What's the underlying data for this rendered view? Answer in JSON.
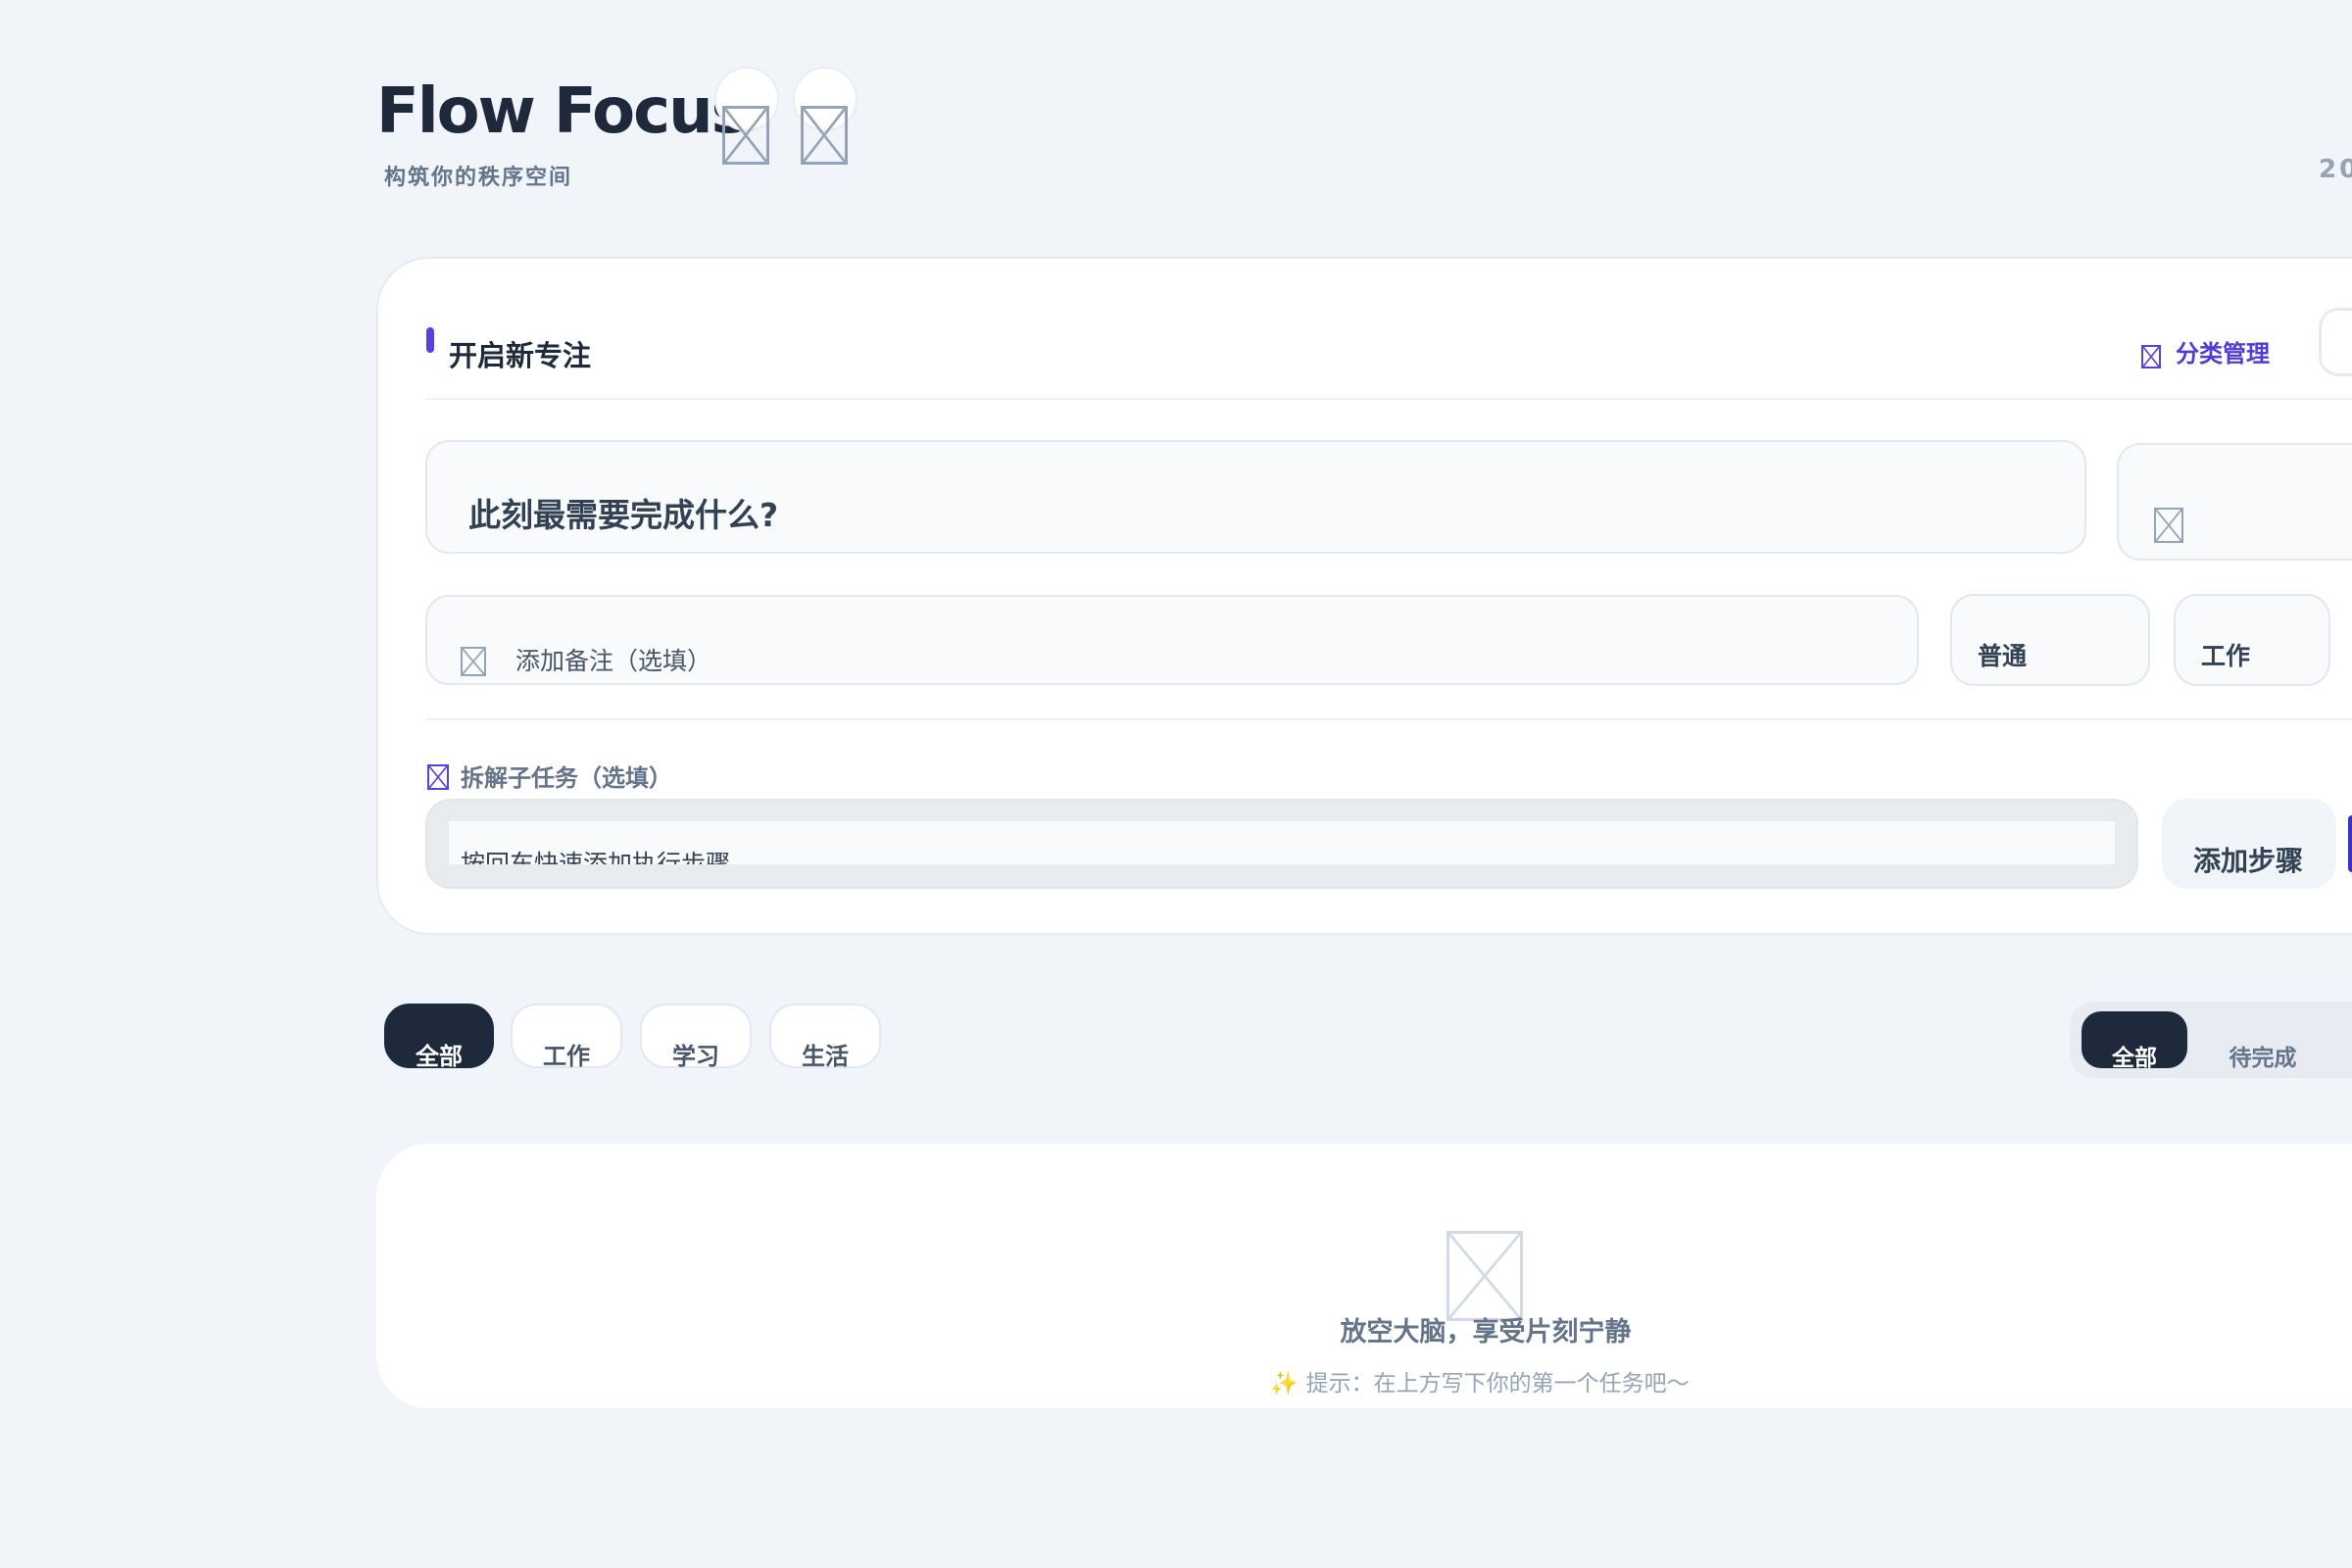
{
  "header": {
    "title": "Flow Focus",
    "subtitle": "构筑你的秩序空间",
    "date_fragment": "20"
  },
  "composer": {
    "section_title": "开启新专注",
    "category_manage_label": "分类管理",
    "task_placeholder": "此刻最需要完成什么?",
    "note_placeholder": "添加备注（选填）",
    "priority_value": "普通",
    "category_value": "工作",
    "subtask_label": "拆解子任务（选填）",
    "subtask_placeholder": "按回车快速添加执行步骤",
    "add_step_label": "添加步骤"
  },
  "filters": {
    "categories": [
      {
        "label": "全部",
        "active": true
      },
      {
        "label": "工作",
        "active": false
      },
      {
        "label": "学习",
        "active": false
      },
      {
        "label": "生活",
        "active": false
      }
    ],
    "status": [
      {
        "label": "全部",
        "active": true
      },
      {
        "label": "待完成",
        "active": false
      }
    ]
  },
  "empty_state": {
    "title": "放空大脑，享受片刻宁静",
    "hint": "提示：在上方写下你的第一个任务吧～"
  },
  "icons": {
    "header_icon_1": "broken-image-icon",
    "header_icon_2": "broken-image-icon",
    "category_manage_icon": "broken-image-icon",
    "side_field_icon": "broken-image-icon",
    "note_icon": "broken-image-icon",
    "subtask_icon": "broken-image-icon",
    "empty_icon": "broken-image-icon",
    "hint_icon": "sparkles-icon"
  },
  "colors": {
    "background": "#f1f4f9",
    "accent": "#5b3fe0",
    "dark": "#1e293b",
    "muted": "#64748b"
  }
}
